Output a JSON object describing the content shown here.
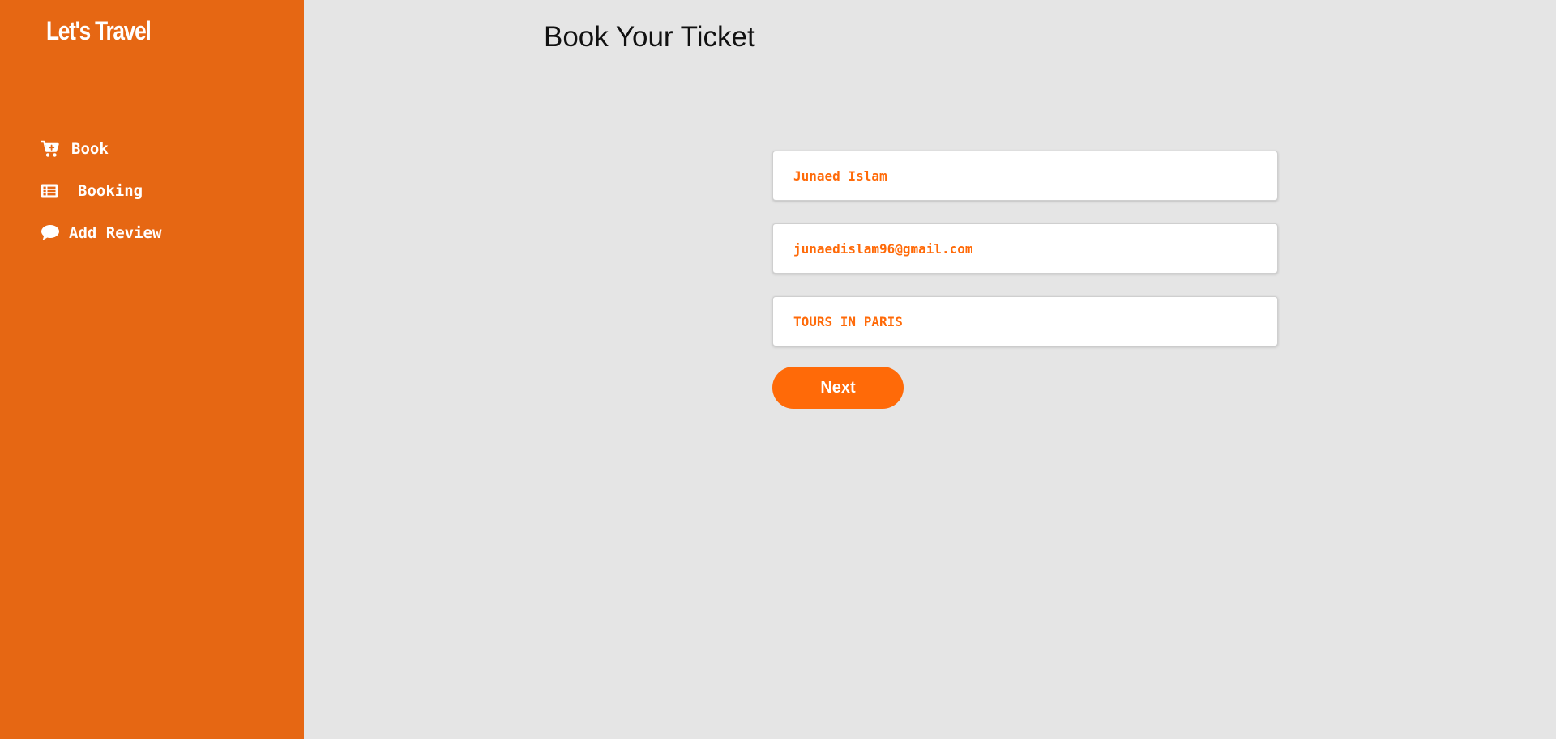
{
  "brand": {
    "logo_text": "Let's Travel"
  },
  "sidebar": {
    "items": [
      {
        "label": "Book",
        "icon": "cart-plus-icon"
      },
      {
        "label": "Booking",
        "icon": "list-icon"
      },
      {
        "label": "Add Review",
        "icon": "comment-icon"
      }
    ]
  },
  "main": {
    "title": "Book Your Ticket",
    "form": {
      "name_value": "Junaed Islam",
      "email_value": "junaedislam96@gmail.com",
      "tour_value": "TOURS IN PARIS",
      "next_label": "Next"
    }
  },
  "colors": {
    "sidebar_bg": "#e66713",
    "main_bg": "#e5e5e5",
    "accent": "#ff6a08",
    "input_text": "#ff6a08"
  }
}
